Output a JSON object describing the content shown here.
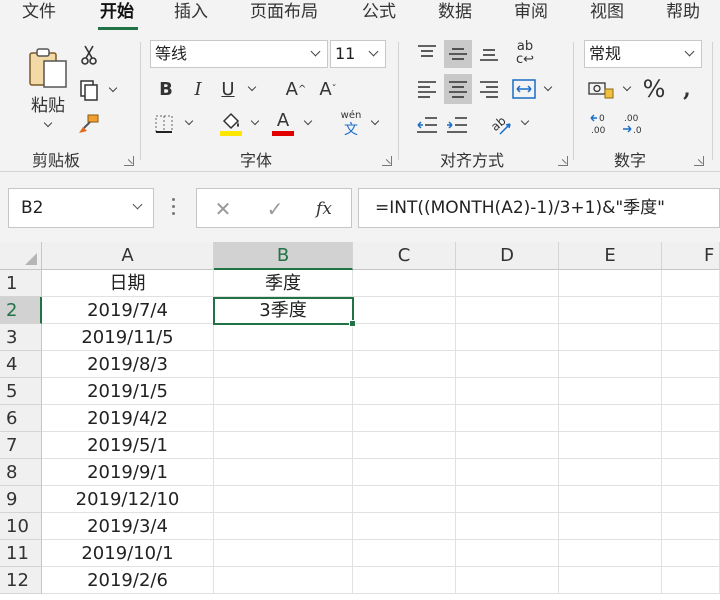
{
  "menu": {
    "tabs": [
      {
        "label": "文件"
      },
      {
        "label": "开始"
      },
      {
        "label": "插入"
      },
      {
        "label": "页面布局"
      },
      {
        "label": "公式"
      },
      {
        "label": "数据"
      },
      {
        "label": "审阅"
      },
      {
        "label": "视图"
      },
      {
        "label": "帮助"
      }
    ],
    "active_tab": "开始"
  },
  "ribbon": {
    "clipboard": {
      "label": "剪贴板",
      "paste_label": "粘贴"
    },
    "font": {
      "label": "字体",
      "font_name": "等线",
      "font_size": "11",
      "bold": "B",
      "italic": "I",
      "underline": "U",
      "grow": "A",
      "shrink": "A",
      "phonetic_top": "wén",
      "phonetic_bottom": "文",
      "font_color": "A"
    },
    "alignment": {
      "label": "对齐方式",
      "wrap": "ab"
    },
    "number": {
      "label": "数字",
      "format": "常规",
      "percent": "%",
      "comma": "❩"
    }
  },
  "formula_bar": {
    "name_box": "B2",
    "cancel": "✕",
    "enter": "✓",
    "fx": "fx",
    "formula": "=INT((MONTH(A2)-1)/3+1)&\"季度\""
  },
  "grid": {
    "columns": [
      "A",
      "B",
      "C",
      "D",
      "E",
      "F"
    ],
    "selected_column": "B",
    "rows": [
      {
        "num": "1",
        "a": "日期",
        "b": "季度"
      },
      {
        "num": "2",
        "a": "2019/7/4",
        "b": "3季度"
      },
      {
        "num": "3",
        "a": "2019/11/5",
        "b": ""
      },
      {
        "num": "4",
        "a": "2019/8/3",
        "b": ""
      },
      {
        "num": "5",
        "a": "2019/1/5",
        "b": ""
      },
      {
        "num": "6",
        "a": "2019/4/2",
        "b": ""
      },
      {
        "num": "7",
        "a": "2019/5/1",
        "b": ""
      },
      {
        "num": "8",
        "a": "2019/9/1",
        "b": ""
      },
      {
        "num": "9",
        "a": "2019/12/10",
        "b": ""
      },
      {
        "num": "10",
        "a": "2019/3/4",
        "b": ""
      },
      {
        "num": "11",
        "a": "2019/10/1",
        "b": ""
      },
      {
        "num": "12",
        "a": "2019/2/6",
        "b": ""
      }
    ],
    "selected_row": "2"
  },
  "colors": {
    "accent": "#217346",
    "font_highlight": "#ffe600",
    "font_color": "#e00000"
  }
}
